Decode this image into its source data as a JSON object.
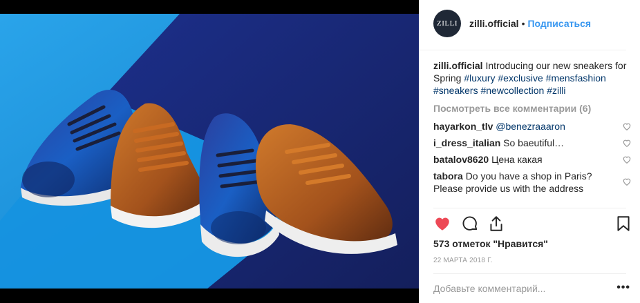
{
  "post": {
    "avatar_text": "ZILLI",
    "username": "zilli.official",
    "separator": "•",
    "follow_label": "Подписаться"
  },
  "caption": {
    "username": "zilli.official",
    "text": " Introducing our new sneakers for Spring ",
    "tags": [
      "#luxury",
      "#exclusive",
      "#mensfashion",
      "#sneakers",
      "#newcollection",
      "#zilli"
    ]
  },
  "view_all_comments": "Посмотреть все комментарии (6)",
  "comments": [
    {
      "user": "hayarkon_tlv",
      "text": "",
      "mention": "@benezraaaron"
    },
    {
      "user": "i_dress_italian",
      "text": "So baeutiful…",
      "mention": ""
    },
    {
      "user": "batalov8620",
      "text": "Цена какая",
      "mention": ""
    },
    {
      "user": "tabora",
      "text": "Do you have a shop in Paris? Please provide us with the address",
      "mention": ""
    }
  ],
  "likes_text": "573 отметок \"Нравится\"",
  "date_text": "22 МАРТА 2018 Г.",
  "add_comment_placeholder": "Добавьте комментарий...",
  "more_label": "•••",
  "icons": {
    "like": "heart-filled-icon",
    "comment": "comment-bubble-icon",
    "share": "share-icon",
    "save": "bookmark-icon",
    "comment_like": "heart-outline-icon"
  },
  "colors": {
    "like_red": "#ed4956",
    "link_blue": "#3897f0",
    "hashtag": "#003569",
    "muted": "#999999",
    "bg_light_blue": "#1a8fd8",
    "bg_dark_navy": "#1a2a78"
  }
}
